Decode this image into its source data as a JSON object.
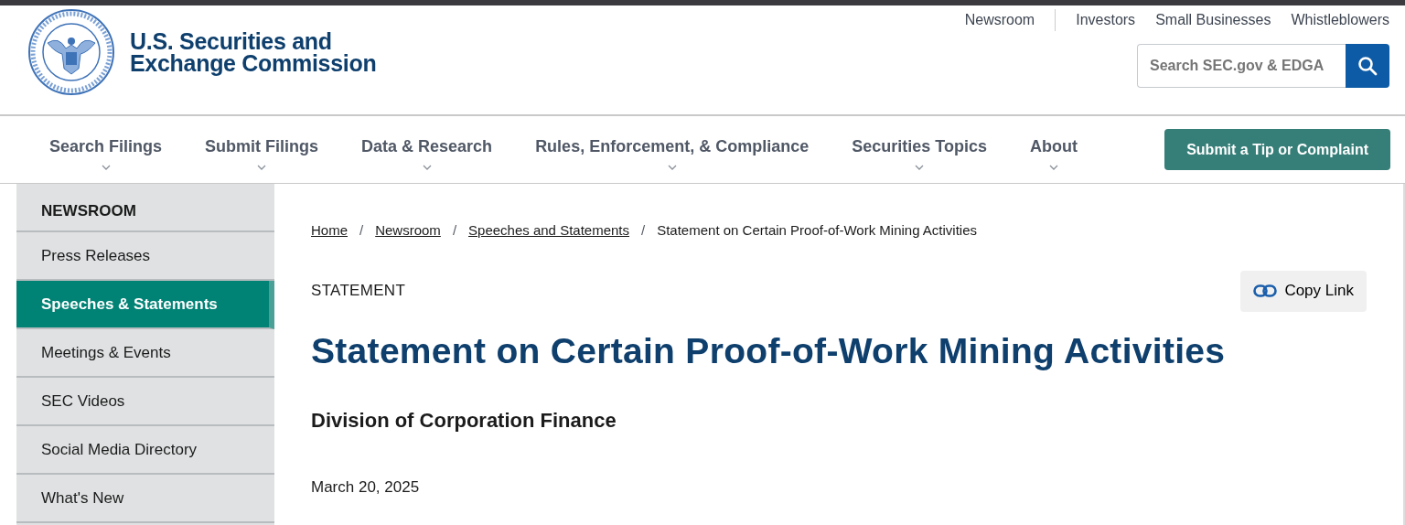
{
  "agency": {
    "name_line_1": "U.S. Securities and",
    "name_line_2": "Exchange Commission"
  },
  "utility_links": [
    {
      "label": "Newsroom",
      "divider_after": true
    },
    {
      "label": "Investors",
      "divider_after": false
    },
    {
      "label": "Small Businesses",
      "divider_after": false
    },
    {
      "label": "Whistleblowers",
      "divider_after": false
    }
  ],
  "search": {
    "placeholder": "Search SEC.gov & EDGA"
  },
  "main_nav": [
    {
      "label": "Search Filings",
      "has_menu": true
    },
    {
      "label": "Submit Filings",
      "has_menu": true
    },
    {
      "label": "Data & Research",
      "has_menu": true
    },
    {
      "label": "Rules, Enforcement, & Compliance",
      "has_menu": true
    },
    {
      "label": "Securities Topics",
      "has_menu": true
    },
    {
      "label": "About",
      "has_menu": true
    }
  ],
  "tip_button": "Submit a Tip or Complaint",
  "sidebar": {
    "heading": "NEWSROOM",
    "items": [
      {
        "label": "Press Releases",
        "selected": false
      },
      {
        "label": "Speeches & Statements",
        "selected": true
      },
      {
        "label": "Meetings & Events",
        "selected": false
      },
      {
        "label": "SEC Videos",
        "selected": false
      },
      {
        "label": "Social Media Directory",
        "selected": false
      },
      {
        "label": "What's New",
        "selected": false
      }
    ]
  },
  "breadcrumb": [
    {
      "label": "Home",
      "link": true
    },
    {
      "separator": "/",
      "label": "Newsroom",
      "link": true
    },
    {
      "separator": "/",
      "label": "Speeches and Statements",
      "link": true
    },
    {
      "separator": "/",
      "label": "Statement on Certain Proof-of-Work Mining Activities",
      "link": false
    }
  ],
  "article": {
    "type": "STATEMENT",
    "copy_button": "Copy Link",
    "title": "Statement on Certain Proof-of-Work Mining Activities",
    "author": "Division of Corporation Finance",
    "date": "March 20, 2025"
  }
}
